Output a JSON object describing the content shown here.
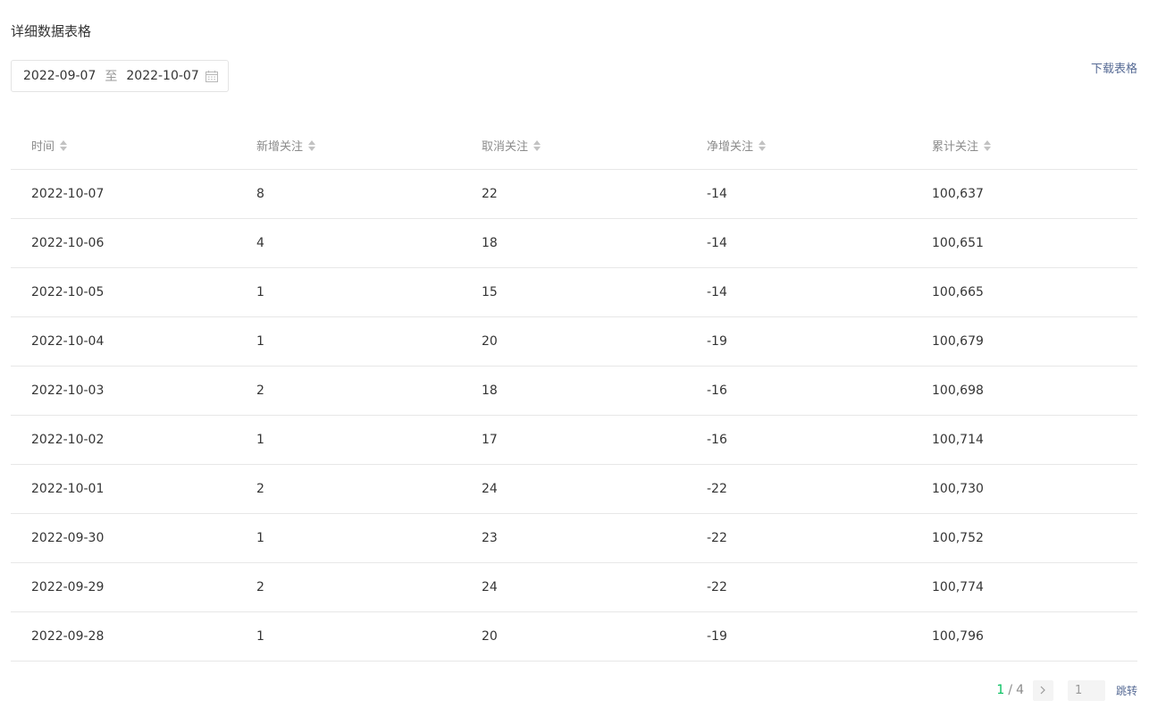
{
  "section": {
    "title": "详细数据表格"
  },
  "date_range": {
    "start": "2022-09-07",
    "separator": "至",
    "end": "2022-10-07"
  },
  "download": {
    "label": "下载表格"
  },
  "table": {
    "headers": [
      "时间",
      "新增关注",
      "取消关注",
      "净增关注",
      "累计关注"
    ],
    "rows": [
      [
        "2022-10-07",
        "8",
        "22",
        "-14",
        "100,637"
      ],
      [
        "2022-10-06",
        "4",
        "18",
        "-14",
        "100,651"
      ],
      [
        "2022-10-05",
        "1",
        "15",
        "-14",
        "100,665"
      ],
      [
        "2022-10-04",
        "1",
        "20",
        "-19",
        "100,679"
      ],
      [
        "2022-10-03",
        "2",
        "18",
        "-16",
        "100,698"
      ],
      [
        "2022-10-02",
        "1",
        "17",
        "-16",
        "100,714"
      ],
      [
        "2022-10-01",
        "2",
        "24",
        "-22",
        "100,730"
      ],
      [
        "2022-09-30",
        "1",
        "23",
        "-22",
        "100,752"
      ],
      [
        "2022-09-29",
        "2",
        "24",
        "-22",
        "100,774"
      ],
      [
        "2022-09-28",
        "1",
        "20",
        "-19",
        "100,796"
      ]
    ]
  },
  "pagination": {
    "current": "1",
    "separator": "/",
    "total": "4",
    "input_value": "1",
    "jump_label": "跳转"
  },
  "colors": {
    "accent": "#07c160",
    "link": "#576b95",
    "text": "#353535",
    "muted": "#8c8c8c",
    "border": "#e7e7e7"
  }
}
